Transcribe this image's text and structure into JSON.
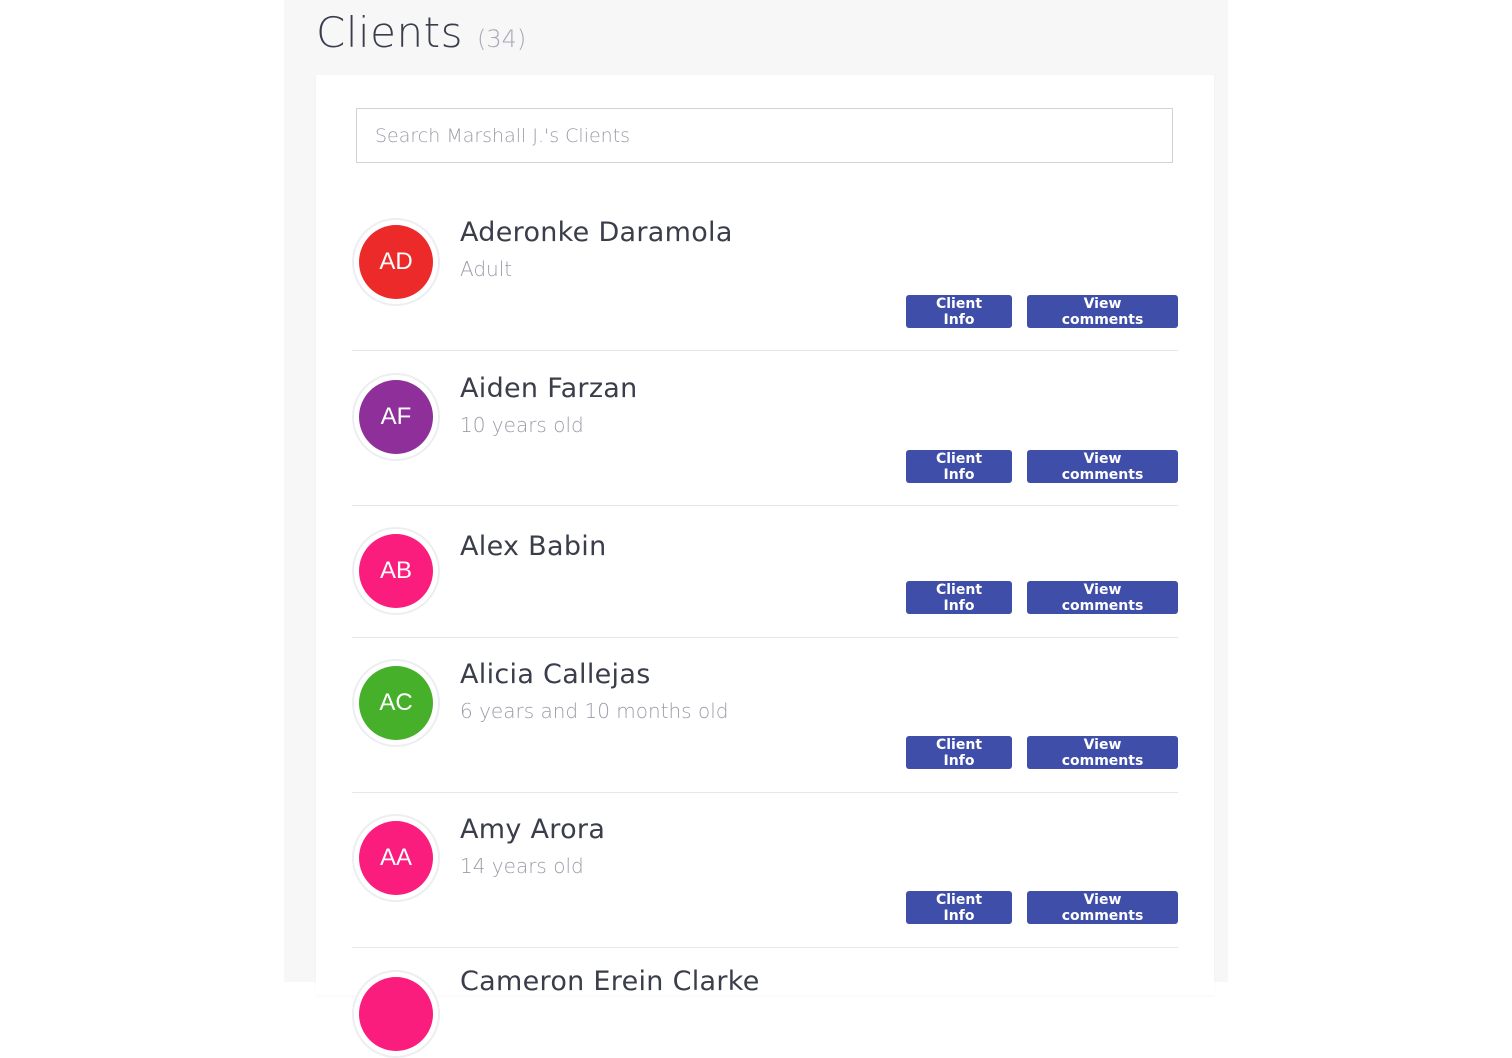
{
  "header": {
    "title": "Clients",
    "count": "(34)"
  },
  "search": {
    "placeholder": "Search Marshall J.'s Clients"
  },
  "buttons": {
    "info": "Client Info",
    "comments": "View comments"
  },
  "clients": [
    {
      "initials": "AD",
      "name": "Aderonke Daramola",
      "age": "Adult",
      "color": "#ec2a2a"
    },
    {
      "initials": "AF",
      "name": "Aiden Farzan",
      "age": "10 years old",
      "color": "#8e2f9a"
    },
    {
      "initials": "AB",
      "name": "Alex Babin",
      "age": "",
      "color": "#fa1d7d"
    },
    {
      "initials": "AC",
      "name": "Alicia Callejas",
      "age": "6 years and 10 months old",
      "color": "#46b02a"
    },
    {
      "initials": "AA",
      "name": "Amy Arora",
      "age": "14 years old",
      "color": "#fa1d7d"
    },
    {
      "initials": "",
      "name": "Cameron Erein Clarke",
      "age": "",
      "color": "#fa1d7d"
    }
  ]
}
